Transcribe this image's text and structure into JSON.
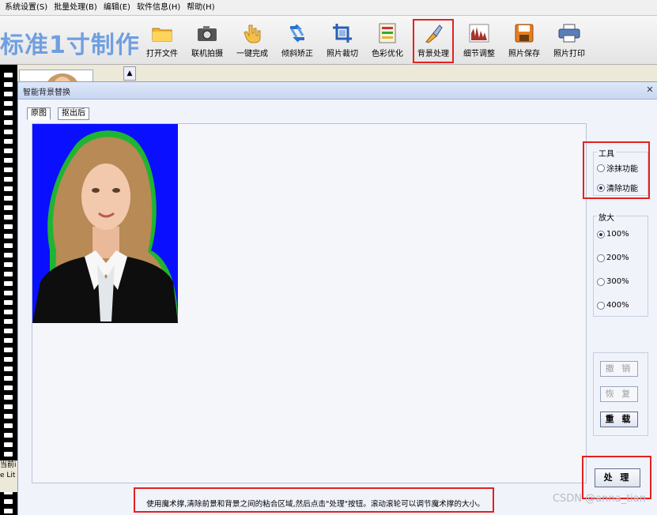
{
  "menu": {
    "items": [
      "系统设置(S)",
      "批量处理(B)",
      "编辑(E)",
      "软件信息(H)",
      "帮助(H)"
    ]
  },
  "app": {
    "title": "标准1寸制作"
  },
  "toolbar": {
    "items": [
      {
        "label": "打开文件",
        "icon": "folder-icon"
      },
      {
        "label": "联机拍摄",
        "icon": "camera-icon"
      },
      {
        "label": "一键完成",
        "icon": "hand-icon"
      },
      {
        "label": "倾斜矫正",
        "icon": "rotate-icon"
      },
      {
        "label": "照片裁切",
        "icon": "crop-icon"
      },
      {
        "label": "色彩优化",
        "icon": "palette-icon"
      },
      {
        "label": "背景处理",
        "icon": "brush-icon"
      },
      {
        "label": "细节调整",
        "icon": "detail-icon"
      },
      {
        "label": "照片保存",
        "icon": "save-icon"
      },
      {
        "label": "照片打印",
        "icon": "printer-icon"
      }
    ],
    "active_label": "背景处理"
  },
  "side": {
    "partial_text": "当前i e Lit"
  },
  "dialog": {
    "title": "智能背景替换",
    "tabs": [
      "原图",
      "抠出后"
    ],
    "tools_group": {
      "title": "工具",
      "options": [
        "涂抹功能",
        "清除功能"
      ],
      "selected": "清除功能"
    },
    "zoom_group": {
      "title": "放大",
      "options": [
        "100%",
        "200%",
        "300%",
        "400%"
      ],
      "selected": "100%"
    },
    "buttons": {
      "undo": "撤 销",
      "redo": "恢 复",
      "reload": "重 载",
      "process": "处 理"
    },
    "hint": "使用魔术撑,清除前景和背景之间的粘合区域,然后点击\"处理\"按钮。滚动滚轮可以调节魔术撑的大小。"
  },
  "watermark": "CSDN @anna_tian",
  "colors": {
    "highlight": "#e52020",
    "photo_background": "#0a10ff",
    "title_blue": "#6f9fe0"
  }
}
